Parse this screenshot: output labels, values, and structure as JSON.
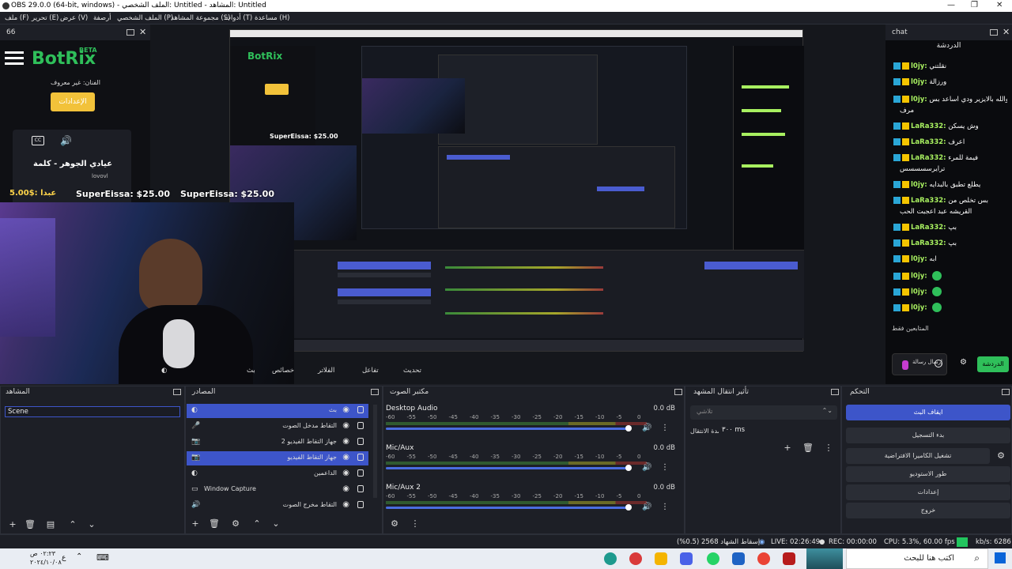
{
  "window": {
    "title": "OBS 29.0.0 (64-bit, windows) - الملف الشخصي: Untitled - المشاهد: Untitled"
  },
  "menu": [
    "ملف (F)",
    "تحرير (E)",
    "عرض (V)",
    "أرصفة",
    "الملف الشخصي (P)",
    "مجموعة المشاهد (S)",
    "أدوات (T)",
    "مساعدة (H)"
  ],
  "left_dock": {
    "title": "66"
  },
  "botrix": {
    "brand": "BotRix",
    "beta": "BETA",
    "artist_label": "الفنان: غير معروف",
    "settings_btn": "الإعدادات",
    "song": "عيادي الجوهر - كلمة",
    "channel": "lovovl",
    "donation": "SuperEissa: $25.00",
    "donation_left": "5.00$: عبدا"
  },
  "chat": {
    "title": "chat",
    "header_label": "الدردشة",
    "messages": [
      {
        "user": "l0jy:",
        "text": "نقلتني"
      },
      {
        "user": "l0jy:",
        "text": "ورزالة"
      },
      {
        "user": "l0jy:",
        "text": "والله بالايزير ودي اساعد بس"
      },
      {
        "user": "",
        "text": "مرف"
      },
      {
        "user": "LaRa332:",
        "text": "وش يسكن"
      },
      {
        "user": "LaRa332:",
        "text": "اعرف"
      },
      {
        "user": "LaRa332:",
        "text": "فيمة للمرء"
      },
      {
        "user": "",
        "text": "ترايرسسسسس"
      },
      {
        "user": "l0jy:",
        "text": "يطلع تطبق بالبدايه"
      },
      {
        "user": "LaRa332:",
        "text": "بس تخلص من"
      },
      {
        "user": "",
        "text": "القريشه عبد اعجبت الحب"
      },
      {
        "user": "LaRa332:",
        "text": "بپ"
      },
      {
        "user": "LaRa332:",
        "text": "بپ"
      },
      {
        "user": "l0jy:",
        "text": "ابه"
      },
      {
        "user": "l0jy:",
        "text": ""
      },
      {
        "user": "l0jy:",
        "text": ""
      },
      {
        "user": "l0jy:",
        "text": ""
      }
    ],
    "footer_label": "المتابعين فقط",
    "send_hint": "إرسال رسالة",
    "chat_btn": "الدردشة"
  },
  "toolbar": {
    "live_label": "بث",
    "props": "خصائص",
    "filters": "الفلاتر",
    "interact": "تفاعل",
    "refresh": "تحديث"
  },
  "scenes": {
    "title": "المشاهد",
    "items": [
      "Scene"
    ]
  },
  "sources": {
    "title": "المصادر",
    "items": [
      {
        "label": "بث",
        "type": "browser",
        "selected": true
      },
      {
        "label": "التقاط مدخل الصوت",
        "type": "mic",
        "selected": false
      },
      {
        "label": "جهاز التقاط الفيديو 2",
        "type": "camera",
        "selected": false
      },
      {
        "label": "جهاز التقاط الفيديو",
        "type": "camera",
        "selected": true
      },
      {
        "label": "الداعمين",
        "type": "browser",
        "selected": false
      },
      {
        "label": "Window Capture",
        "type": "window",
        "selected": false
      },
      {
        "label": "التقاط مخرج الصوت",
        "type": "speaker",
        "selected": false
      }
    ]
  },
  "mixer": {
    "title": "مكتبر الصوت",
    "ticks": [
      "-60",
      "-55",
      "-50",
      "-45",
      "-40",
      "-35",
      "-30",
      "-25",
      "-20",
      "-15",
      "-10",
      "-5",
      "0"
    ],
    "channels": [
      {
        "name": "Desktop Audio",
        "db": "0.0 dB",
        "level": 0.97
      },
      {
        "name": "Mic/Aux",
        "db": "0.0 dB",
        "level": 0.97
      },
      {
        "name": "Mic/Aux 2",
        "db": "0.0 dB",
        "level": 0.97
      }
    ]
  },
  "transitions": {
    "title": "تأثير انتقال المشهد",
    "type_value": "تلاشي",
    "duration_label": "مدة الانتقال",
    "duration_value": "٣٠٠ ms"
  },
  "controls": {
    "title": "التحكم",
    "buttons": [
      "ايقاف البث",
      "بدء التسجيل",
      "تشغيل الكاميرا الافتراضية",
      "طور الاستوديو",
      "إعدادات",
      "خروج"
    ]
  },
  "status": {
    "dropped": "إسقاط الشهاد 2568 (0.5%)",
    "live": "LIVE: 02:26:49",
    "rec": "REC: 00:00:00",
    "cpu": "CPU: 5.3%, 60.00 fps",
    "kbps": "kb/s: 6286"
  },
  "taskbar": {
    "time": "٠٢:٢٣ ص",
    "date": "٢٠٢٤/١٠/٠٨",
    "search": "اكتب هنا للبحث",
    "lang": "ع"
  },
  "colors": {
    "accent": "#3d55c9",
    "chat_user": "#a8f060",
    "status_green": "#22c55e"
  }
}
